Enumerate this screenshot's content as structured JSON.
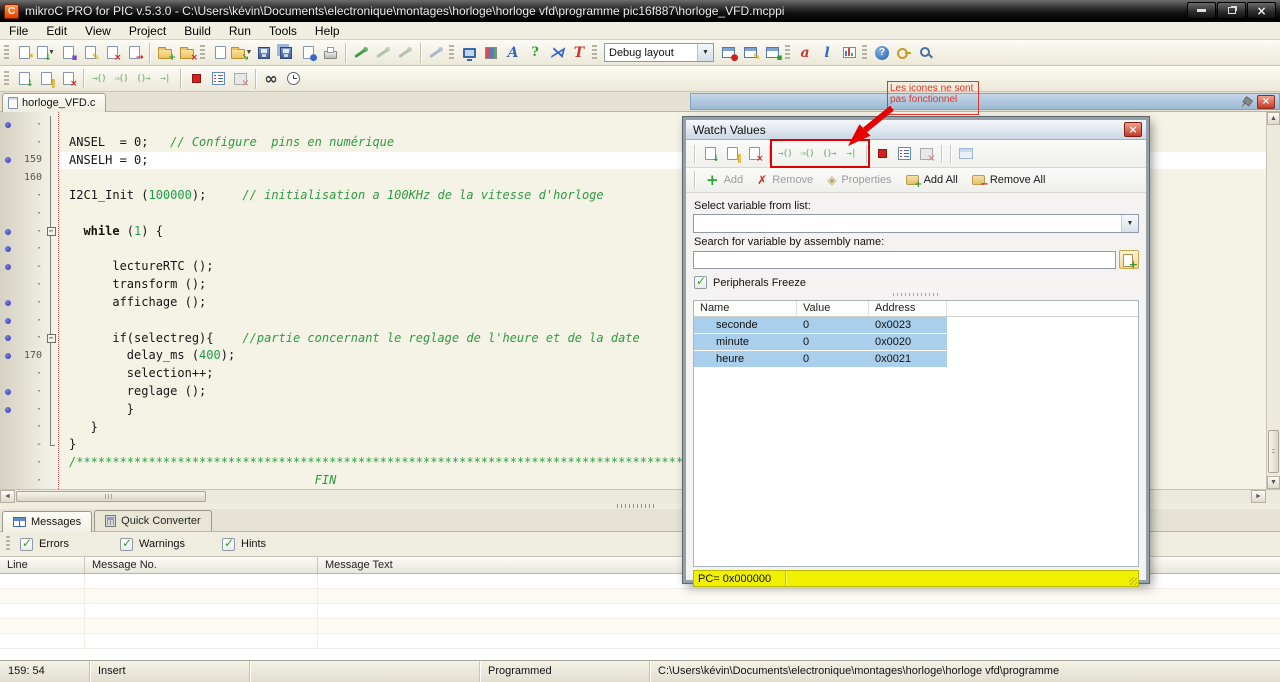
{
  "window": {
    "title": "mikroC PRO for PIC v.5.3.0 - C:\\Users\\kévin\\Documents\\electronique\\montages\\horloge\\horloge vfd\\programme pic16f887\\horloge_VFD.mcppi",
    "app_icon_letter": "C"
  },
  "menu": {
    "items": [
      "File",
      "Edit",
      "View",
      "Project",
      "Build",
      "Run",
      "Tools",
      "Help"
    ]
  },
  "toolbar": {
    "layout_combo": "Debug layout"
  },
  "editor": {
    "tab": "horloge_VFD.c",
    "lines": [
      {
        "m": 1,
        "g": "·",
        "f": "line",
        "segs": []
      },
      {
        "g": "·",
        "f": "line",
        "segs": [
          [
            "ANSEL  = 0;   ",
            "c"
          ],
          [
            "// Configure  pins en numérique",
            "m"
          ]
        ]
      },
      {
        "m": 1,
        "g": "159",
        "f": "line",
        "hl": 1,
        "segs": [
          [
            "ANSELH = 0;",
            "c"
          ]
        ]
      },
      {
        "g": "160",
        "f": "line",
        "segs": []
      },
      {
        "g": "·",
        "f": "line",
        "segs": [
          [
            "I2C1_Init (",
            "c"
          ],
          [
            "100000",
            "n"
          ],
          [
            ");     ",
            "c"
          ],
          [
            "// initialisation a 100KHz de la vitesse d'horloge",
            "m"
          ]
        ]
      },
      {
        "g": "·",
        "f": "line",
        "segs": []
      },
      {
        "m": 1,
        "g": "·",
        "f": "box",
        "segs": [
          [
            "  ",
            "c"
          ],
          [
            "while",
            "k"
          ],
          [
            " (",
            "c"
          ],
          [
            "1",
            "n"
          ],
          [
            ") {",
            "c"
          ]
        ]
      },
      {
        "m": 1,
        "g": "·",
        "f": "line",
        "segs": []
      },
      {
        "m": 1,
        "g": "-",
        "f": "line",
        "segs": [
          [
            "      lectureRTC ();",
            "c"
          ]
        ]
      },
      {
        "g": "·",
        "f": "line",
        "segs": [
          [
            "      transform ();",
            "c"
          ]
        ]
      },
      {
        "m": 1,
        "g": "·",
        "f": "line",
        "segs": [
          [
            "      affichage ();",
            "c"
          ]
        ]
      },
      {
        "m": 1,
        "g": "·",
        "f": "line",
        "segs": []
      },
      {
        "m": 1,
        "g": "·",
        "f": "box",
        "segs": [
          [
            "      if(selectreg){    ",
            "c"
          ],
          [
            "//partie concernant le reglage de l'heure et de la date",
            "m"
          ]
        ]
      },
      {
        "m": 1,
        "g": "170",
        "f": "line",
        "segs": [
          [
            "        delay_ms (",
            "c"
          ],
          [
            "400",
            "n"
          ],
          [
            ");",
            "c"
          ]
        ]
      },
      {
        "g": "·",
        "f": "line",
        "segs": [
          [
            "        selection++;",
            "c"
          ]
        ]
      },
      {
        "m": 1,
        "g": "·",
        "f": "line",
        "segs": [
          [
            "        reglage ();",
            "c"
          ]
        ]
      },
      {
        "m": 1,
        "g": "·",
        "f": "line",
        "segs": [
          [
            "        }",
            "c"
          ]
        ]
      },
      {
        "g": "·",
        "f": "line",
        "segs": [
          [
            "   }",
            "c"
          ]
        ]
      },
      {
        "g": "-",
        "f": "end",
        "segs": [
          [
            "}",
            "c"
          ]
        ]
      },
      {
        "g": "·",
        "f": "",
        "segs": [
          [
            "/************************************************************************************************",
            "m"
          ]
        ]
      },
      {
        "g": "·",
        "f": "",
        "segs": [
          [
            "                                  FIN",
            "m"
          ]
        ]
      }
    ]
  },
  "watch": {
    "title": "Watch Values",
    "buttons": {
      "add": "Add",
      "remove": "Remove",
      "properties": "Properties",
      "add_all": "Add All",
      "remove_all": "Remove All"
    },
    "select_label": "Select variable from list:",
    "search_label": "Search for variable by assembly name:",
    "freeze_label": "Peripherals Freeze",
    "columns": [
      "Name",
      "Value",
      "Address"
    ],
    "rows": [
      {
        "name": "seconde",
        "value": "0",
        "address": "0x0023"
      },
      {
        "name": "minute",
        "value": "0",
        "address": "0x0020"
      },
      {
        "name": "heure",
        "value": "0",
        "address": "0x0021"
      }
    ],
    "pc_label": "PC= 0x000000"
  },
  "annotation": {
    "text": "Les icones ne sont pas fonctionnel",
    "color": "#D93A2B"
  },
  "bottom": {
    "tabs": [
      "Messages",
      "Quick Converter"
    ],
    "filters": [
      "Errors",
      "Warnings",
      "Hints"
    ],
    "columns": [
      "Line",
      "Message No.",
      "Message Text"
    ],
    "empty_row_count": 5
  },
  "status": {
    "cursor": "159: 54",
    "mode": "Insert",
    "state": "Programmed",
    "path": "C:\\Users\\kévin\\Documents\\electronique\\montages\\horloge\\horloge vfd\\programme"
  },
  "colors": {
    "selection_blue": "#A9CFEC",
    "pc_bar_yellow": "#F0F000",
    "annotation_red": "#D93A2B",
    "comment_green": "#2E9B43",
    "editor_bg": "#F5F3E6"
  }
}
